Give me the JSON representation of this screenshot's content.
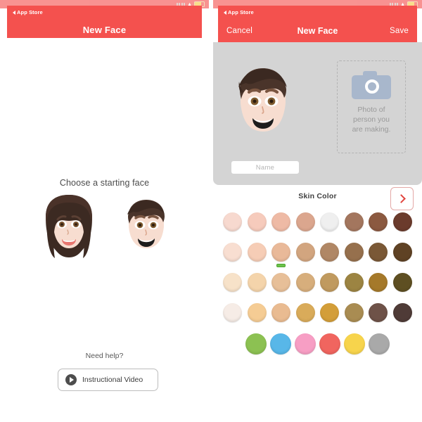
{
  "meta": {
    "accent_red": "#f4514e",
    "gray_card": "#d4d4d4",
    "selected_green": "#6cc24a"
  },
  "statusbar": {
    "back_label": "App Store",
    "wifi_icon": "wifi-icon",
    "battery_icon": "battery-icon"
  },
  "left_panel": {
    "nav": {
      "title": "New Face",
      "back_label": "App Store"
    },
    "choose_label": "Choose a starting face",
    "faces": [
      {
        "name": "female-starting-face",
        "skin": "#f7ddd0",
        "hair": "#4a352c"
      },
      {
        "name": "male-starting-face",
        "skin": "#f7ddd0",
        "hair": "#4a352c"
      }
    ],
    "help_text": "Need help?",
    "video_button": {
      "label": "Instructional Video",
      "icon": "play-icon"
    }
  },
  "right_panel": {
    "nav": {
      "back_label": "App Store",
      "cancel_label": "Cancel",
      "title": "New Face",
      "save_label": "Save"
    },
    "avatar": {
      "name": "male-avatar-preview",
      "skin": "#f7ddd0",
      "hair": "#4a352c"
    },
    "photo_box": {
      "icon": "camera-icon",
      "caption_line1": "Photo of",
      "caption_line2": "person you",
      "caption_line3": "are making."
    },
    "name_input": {
      "placeholder": "Name",
      "value": ""
    },
    "section": {
      "title": "Skin Color",
      "next_button_icon": "chevron-right-icon"
    },
    "swatches": {
      "selected_row": 1,
      "selected_index": 2,
      "rows": [
        [
          "#f7d9cf",
          "#f6cbbc",
          "#eebaa5",
          "#dba68e",
          "#c08straight",
          "#a3765e",
          "#8b5940",
          "#6b3b2c"
        ],
        [
          "#f8ded1",
          "#f6cdb6",
          "#e9b999",
          "#d2a57f",
          "#b08765",
          "#96704d",
          "#7a5836",
          "#5f4224"
        ],
        [
          "#f7e2c9",
          "#f4d4ab",
          "#e7bf98",
          "#d7ae7c",
          "#c09a5f",
          "#9c8442",
          "#a5792a",
          "#5e4f22"
        ],
        [
          "#f6ece6",
          "#f5cc94",
          "#e9bb91",
          "#d9ab5a",
          "#d39e39",
          "#a98c52",
          "#6e5248",
          "#4f3b37"
        ],
        [
          "#8cc152",
          "#58b7e8",
          "#f79ec4",
          "#f0655f",
          "#f7d44c",
          "#a9a9a9"
        ]
      ]
    }
  }
}
